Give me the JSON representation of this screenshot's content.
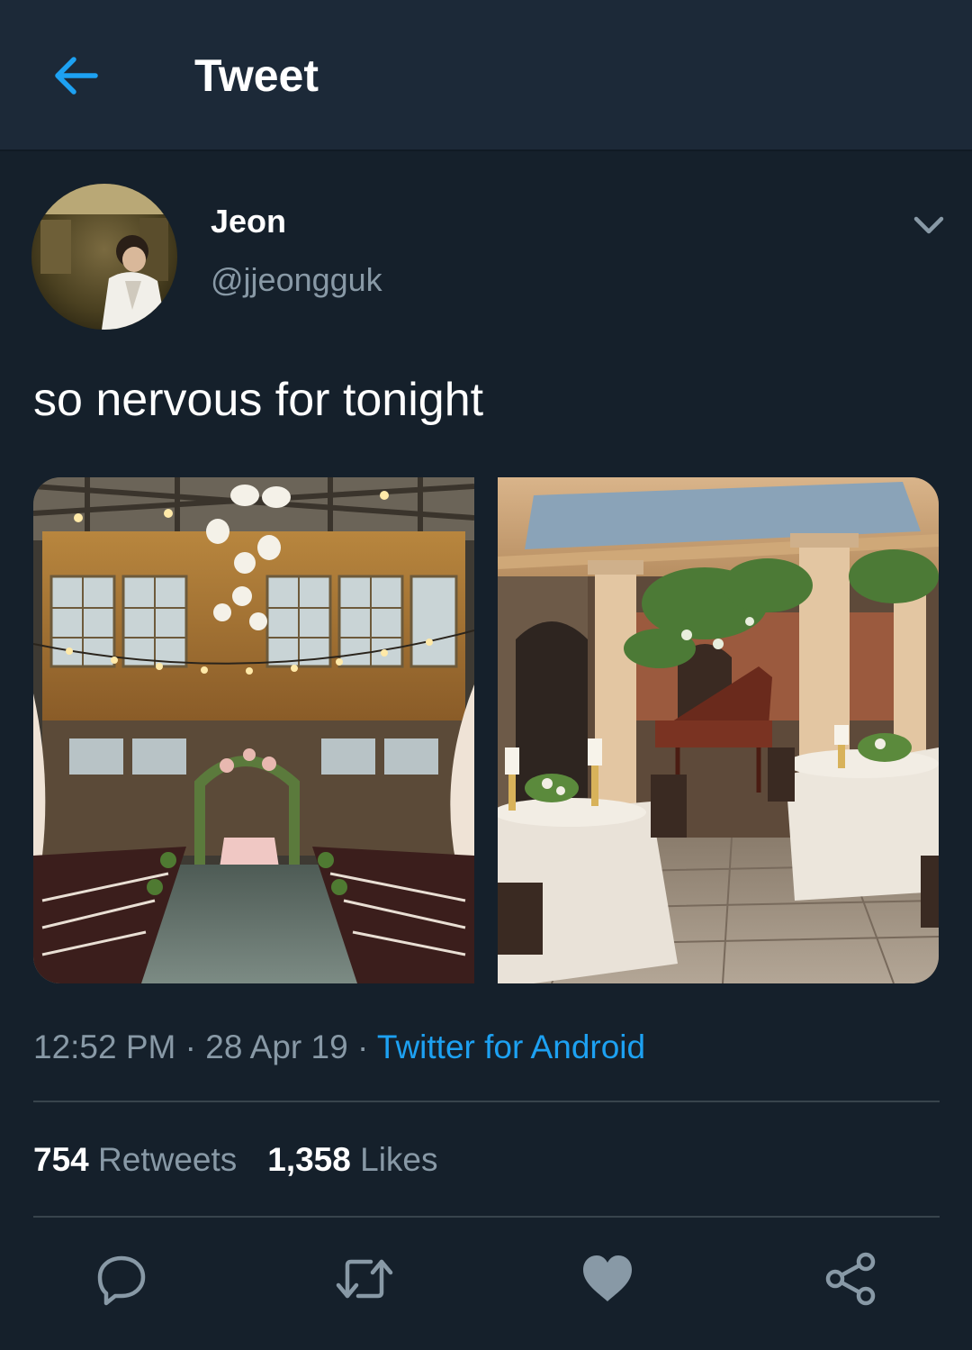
{
  "header": {
    "title": "Tweet",
    "back_icon": "arrow-left-icon"
  },
  "user": {
    "display_name": "Jeon",
    "handle": "@jjeongguk"
  },
  "tweet": {
    "text": "so nervous for tonight",
    "time": "12:52 PM",
    "separator": "·",
    "date": "28 Apr 19",
    "source": "Twitter for Android"
  },
  "stats": {
    "retweets_count": "754",
    "retweets_label": "Retweets",
    "likes_count": "1,358",
    "likes_label": "Likes"
  },
  "actions": [
    "reply-icon",
    "retweet-icon",
    "like-icon",
    "share-icon"
  ],
  "colors": {
    "background": "#15202b",
    "header": "#1c2938",
    "accent": "#1da1f2",
    "secondary_text": "#8899a6",
    "icon": "#8899a6",
    "divider": "#38444d"
  }
}
